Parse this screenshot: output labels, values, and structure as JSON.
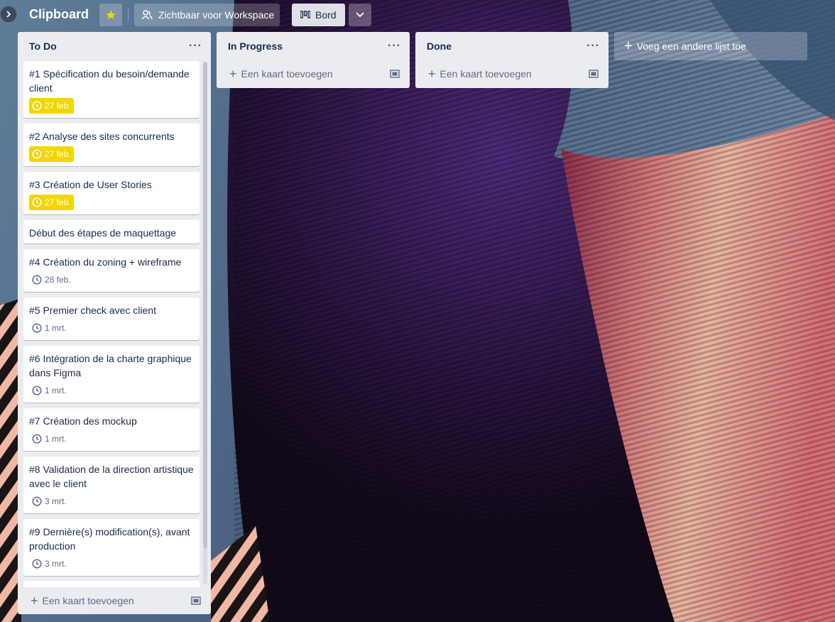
{
  "header": {
    "title": "Clipboard",
    "visibility_label": "Zichtbaar voor Workspace",
    "view_label": "Bord"
  },
  "icons": {
    "expand": "chevron-right-icon",
    "star": "star-icon",
    "visibility": "people-icon",
    "board": "board-icon",
    "more": "chevron-down-icon",
    "clock": "clock-icon",
    "template": "card-template-icon",
    "menu": "more-horizontal-icon",
    "add": "plus-icon"
  },
  "colors": {
    "due_badge": "#f2d600",
    "list_bg": "#ebecf0",
    "star": "#f2d600"
  },
  "lists": [
    {
      "title": "To Do",
      "cards": [
        {
          "title": "#1 Spécification du besoin/demande client",
          "due": "27 feb.",
          "due_style": "due"
        },
        {
          "title": "#2 Analyse des sites concurrents",
          "due": "27 feb.",
          "due_style": "due"
        },
        {
          "title": "#3 Création de User Stories",
          "due": "27 feb.",
          "due_style": "due"
        },
        {
          "title": "Début des étapes de maquettage",
          "due": "",
          "due_style": ""
        },
        {
          "title": "#4 Création du zoning + wireframe",
          "due": "28 feb.",
          "due_style": "plain"
        },
        {
          "title": "#5 Premier check avec client",
          "due": "1 mrt.",
          "due_style": "plain"
        },
        {
          "title": "#6 Intégration de la charte graphique dans Figma",
          "due": "1 mrt.",
          "due_style": "plain"
        },
        {
          "title": "#7 Création des mockup",
          "due": "1 mrt.",
          "due_style": "plain"
        },
        {
          "title": "#8 Validation de la direction artistique avec le client",
          "due": "3 mrt.",
          "due_style": "plain"
        },
        {
          "title": "#9 Dernière(s) modification(s), avant production",
          "due": "3 mrt.",
          "due_style": "plain"
        }
      ],
      "add_card_label": "Een kaart toevoegen"
    },
    {
      "title": "In Progress",
      "cards": [],
      "add_card_label": "Een kaart toevoegen"
    },
    {
      "title": "Done",
      "cards": [],
      "add_card_label": "Een kaart toevoegen"
    }
  ],
  "add_list_label": "Voeg een andere lijst toe"
}
